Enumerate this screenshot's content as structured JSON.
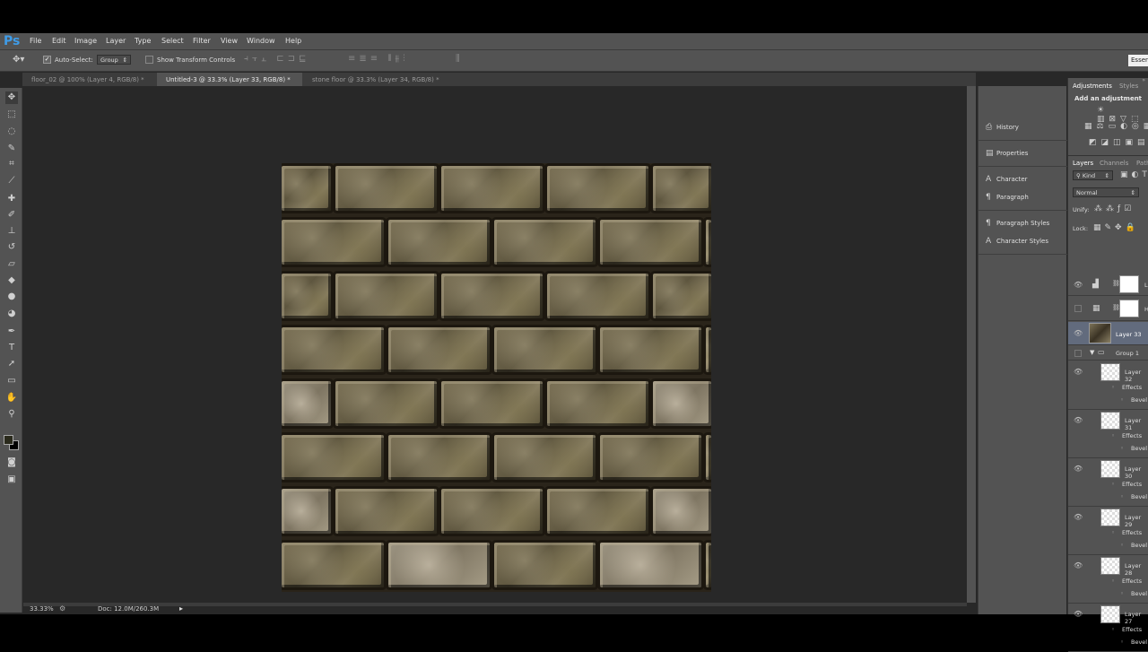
{
  "menubar": {
    "logo": "Ps",
    "items": [
      "File",
      "Edit",
      "Image",
      "Layer",
      "Type",
      "Select",
      "Filter",
      "View",
      "Window",
      "Help"
    ]
  },
  "options": {
    "auto_select_label": "Auto-Select:",
    "auto_select_value": "Group",
    "transform_label": "Show Transform Controls",
    "workspace": "Essen"
  },
  "tabs": [
    {
      "label": "floor_02 @ 100% (Layer 4, RGB/8) *",
      "active": false
    },
    {
      "label": "Untitled-3 @ 33.3% (Layer 33, RGB/8) *",
      "active": true
    },
    {
      "label": "stone floor @ 33.3% (Layer 34, RGB/8) *",
      "active": false
    }
  ],
  "status": {
    "zoom": "33.33%",
    "doc": "Doc: 12.0M/260.3M"
  },
  "mid_panel": {
    "history": "History",
    "properties": "Properties",
    "character": "Character",
    "paragraph": "Paragraph",
    "paragraph_styles": "Paragraph Styles",
    "character_styles": "Character Styles"
  },
  "adjustments": {
    "tab1": "Adjustments",
    "tab2": "Styles",
    "heading": "Add an adjustment"
  },
  "layers_panel": {
    "tabs": [
      "Layers",
      "Channels",
      "Path"
    ],
    "kind": "Kind",
    "blend": "Normal",
    "unify_label": "Unify:",
    "lock_label": "Lock:",
    "rows": [
      {
        "name": "L",
        "type": "adjustment"
      },
      {
        "name": "H",
        "type": "adjustment"
      },
      {
        "name": "Layer 33",
        "type": "image",
        "selected": true
      },
      {
        "name": "Group 1",
        "type": "group"
      },
      {
        "name": "Layer 32",
        "type": "layer"
      },
      {
        "name": "Effects",
        "type": "effects"
      },
      {
        "name": "Bevel",
        "type": "effect"
      },
      {
        "name": "Layer 31",
        "type": "layer"
      },
      {
        "name": "Effects",
        "type": "effects"
      },
      {
        "name": "Bevel",
        "type": "effect"
      },
      {
        "name": "Layer 30",
        "type": "layer"
      },
      {
        "name": "Effects",
        "type": "effects"
      },
      {
        "name": "Bevel",
        "type": "effect"
      },
      {
        "name": "Layer 29",
        "type": "layer"
      },
      {
        "name": "Effects",
        "type": "effects"
      },
      {
        "name": "Bevel",
        "type": "effect"
      },
      {
        "name": "Layer 28",
        "type": "layer"
      },
      {
        "name": "Effects",
        "type": "effects"
      },
      {
        "name": "Bevel",
        "type": "effect"
      },
      {
        "name": "Layer 27",
        "type": "layer"
      },
      {
        "name": "Effects",
        "type": "effects"
      },
      {
        "name": "Bevel",
        "type": "effect"
      }
    ]
  },
  "tools": [
    "move-icon",
    "marquee-icon",
    "lasso-icon",
    "quick-select-icon",
    "crop-icon",
    "eyedropper-icon",
    "healing-icon",
    "brush-icon",
    "clone-stamp-icon",
    "history-brush-icon",
    "eraser-icon",
    "paint-bucket-icon",
    "blur-icon",
    "dodge-icon",
    "pen-icon",
    "type-icon",
    "path-select-icon",
    "rectangle-icon",
    "hand-icon",
    "zoom-icon"
  ],
  "colors": {
    "foreground": "#2a2a1c",
    "background": "#000000",
    "accent": "#3f9ce8"
  }
}
